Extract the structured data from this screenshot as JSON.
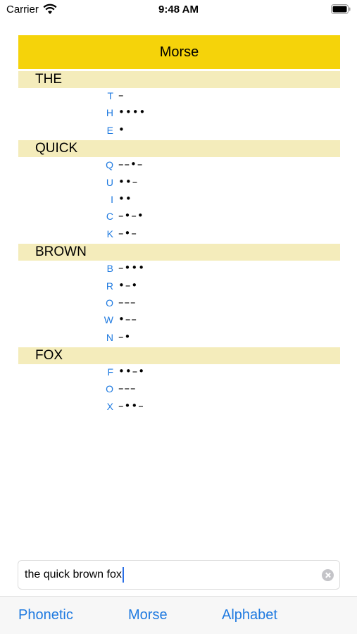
{
  "status_bar": {
    "carrier": "Carrier",
    "time": "9:48 AM",
    "icons": [
      "wifi-icon",
      "battery-icon"
    ]
  },
  "header": {
    "title": "Morse"
  },
  "words": [
    {
      "word": "THE",
      "letters": [
        {
          "char": "T",
          "code": "–"
        },
        {
          "char": "H",
          "code": "••••"
        },
        {
          "char": "E",
          "code": "•"
        }
      ]
    },
    {
      "word": "QUICK",
      "letters": [
        {
          "char": "Q",
          "code": "––•–"
        },
        {
          "char": "U",
          "code": "••–"
        },
        {
          "char": "I",
          "code": "••"
        },
        {
          "char": "C",
          "code": "–•–•"
        },
        {
          "char": "K",
          "code": "–•–"
        }
      ]
    },
    {
      "word": "BROWN",
      "letters": [
        {
          "char": "B",
          "code": "–•••"
        },
        {
          "char": "R",
          "code": "•–•"
        },
        {
          "char": "O",
          "code": "–––"
        },
        {
          "char": "W",
          "code": "•––"
        },
        {
          "char": "N",
          "code": "–•"
        }
      ]
    },
    {
      "word": "FOX",
      "letters": [
        {
          "char": "F",
          "code": "••–•"
        },
        {
          "char": "O",
          "code": "–––"
        },
        {
          "char": "X",
          "code": "–••–"
        }
      ]
    }
  ],
  "search": {
    "value": "the quick brown fox"
  },
  "tabs": [
    {
      "label": "Phonetic"
    },
    {
      "label": "Morse"
    },
    {
      "label": "Alphabet"
    }
  ],
  "colors": {
    "header_bg": "#f5d30a",
    "word_header_bg": "#f4ecbb",
    "accent": "#1f7ae0"
  }
}
